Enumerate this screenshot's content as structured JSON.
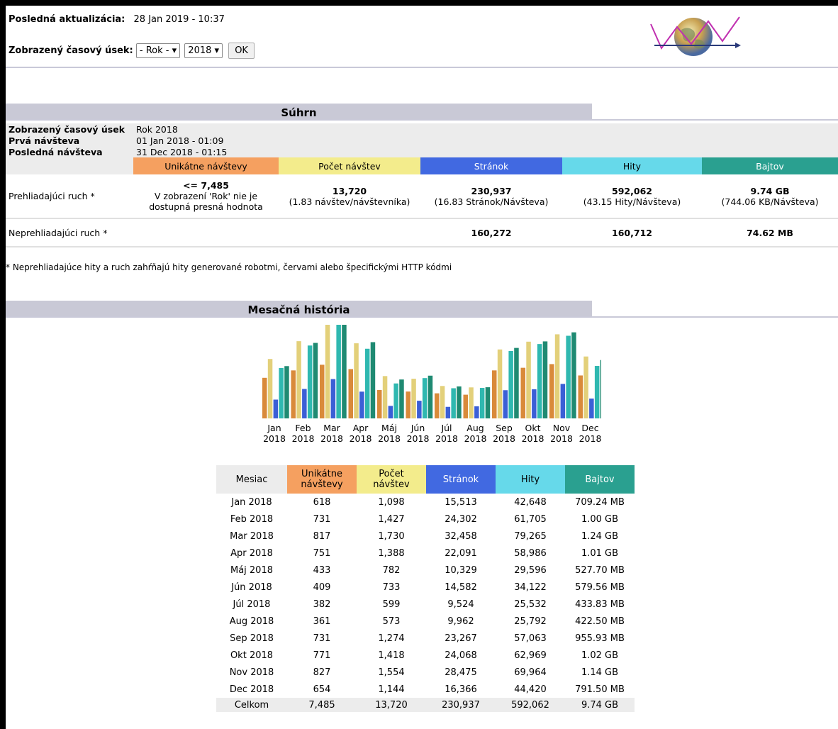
{
  "header": {
    "last_update_label": "Posledná aktualizácia:",
    "last_update_value": "28 Jan 2019 - 10:37",
    "period_label": "Zobrazený časový úsek:",
    "period_select_value": "- Rok -",
    "year_select_value": "2018",
    "ok_label": "OK"
  },
  "summary": {
    "title": "Súhrn",
    "rows": [
      {
        "label": "Zobrazený časový úsek",
        "value": "Rok 2018"
      },
      {
        "label": "Prvá návšteva",
        "value": "01 Jan 2018 - 01:09"
      },
      {
        "label": "Posledná návšteva",
        "value": "31 Dec 2018 - 01:15"
      }
    ],
    "col_headers": [
      "Unikátne návštevy",
      "Počet návštev",
      "Stránok",
      "Hity",
      "Bajtov"
    ],
    "viewed": {
      "label": "Prehliadajúci ruch *",
      "uniq_value": "<= 7,485",
      "uniq_note_1": "V zobrazení 'Rok' nie je",
      "uniq_note_2": "dostupná presná hodnota",
      "visits_value": "13,720",
      "visits_note": "(1.83 návštev/návštevníka)",
      "pages_value": "230,937",
      "pages_note": "(16.83 Stránok/Návšteva)",
      "hits_value": "592,062",
      "hits_note": "(43.15 Hity/Návšteva)",
      "bytes_value": "9.74 GB",
      "bytes_note": "(744.06 KB/Návšteva)"
    },
    "nonviewed": {
      "label": "Neprehliadajúci ruch *",
      "pages_value": "160,272",
      "hits_value": "160,712",
      "bytes_value": "74.62 MB"
    },
    "footnote": "* Neprehliadajúce hity a ruch zahŕňajú hity generované robotmi, červami alebo špecifickými HTTP kódmi"
  },
  "monthly": {
    "title": "Mesačná história",
    "headers": [
      "Mesiac",
      "Unikátne návštevy",
      "Počet návštev",
      "Stránok",
      "Hity",
      "Bajtov"
    ],
    "rows": [
      [
        "Jan 2018",
        "618",
        "1,098",
        "15,513",
        "42,648",
        "709.24 MB"
      ],
      [
        "Feb 2018",
        "731",
        "1,427",
        "24,302",
        "61,705",
        "1.00 GB"
      ],
      [
        "Mar 2018",
        "817",
        "1,730",
        "32,458",
        "79,265",
        "1.24 GB"
      ],
      [
        "Apr 2018",
        "751",
        "1,388",
        "22,091",
        "58,986",
        "1.01 GB"
      ],
      [
        "Máj 2018",
        "433",
        "782",
        "10,329",
        "29,596",
        "527.70 MB"
      ],
      [
        "Jún 2018",
        "409",
        "733",
        "14,582",
        "34,122",
        "579.56 MB"
      ],
      [
        "Júl 2018",
        "382",
        "599",
        "9,524",
        "25,532",
        "433.83 MB"
      ],
      [
        "Aug 2018",
        "361",
        "573",
        "9,962",
        "25,792",
        "422.50 MB"
      ],
      [
        "Sep 2018",
        "731",
        "1,274",
        "23,267",
        "57,063",
        "955.93 MB"
      ],
      [
        "Okt 2018",
        "771",
        "1,418",
        "24,068",
        "62,969",
        "1.02 GB"
      ],
      [
        "Nov 2018",
        "827",
        "1,554",
        "28,475",
        "69,964",
        "1.14 GB"
      ],
      [
        "Dec 2018",
        "654",
        "1,144",
        "16,366",
        "44,420",
        "791.50 MB"
      ]
    ],
    "total": [
      "Celkom",
      "7,485",
      "13,720",
      "230,937",
      "592,062",
      "9.74 GB"
    ]
  },
  "chart_data": {
    "type": "bar",
    "categories": [
      "Jan 2018",
      "Feb 2018",
      "Mar 2018",
      "Apr 2018",
      "Máj 2018",
      "Jún 2018",
      "Júl 2018",
      "Aug 2018",
      "Sep 2018",
      "Okt 2018",
      "Nov 2018",
      "Dec 2018"
    ],
    "month_labels": [
      "Jan",
      "Feb",
      "Mar",
      "Apr",
      "Máj",
      "Jún",
      "Júl",
      "Aug",
      "Sep",
      "Okt",
      "Nov",
      "Dec"
    ],
    "year_label": "2018",
    "series": [
      {
        "name": "Unikátne návštevy",
        "values": [
          618,
          731,
          817,
          751,
          433,
          409,
          382,
          361,
          731,
          771,
          827,
          654
        ],
        "color": "#d98a3a"
      },
      {
        "name": "Počet návštev",
        "values": [
          1098,
          1427,
          1730,
          1388,
          782,
          733,
          599,
          573,
          1274,
          1418,
          1554,
          1144
        ],
        "color": "#e3d07a"
      },
      {
        "name": "Stránok",
        "values": [
          15513,
          24302,
          32458,
          22091,
          10329,
          14582,
          9524,
          9962,
          23267,
          24068,
          28475,
          16366
        ],
        "color": "#3b5fd6"
      },
      {
        "name": "Hity",
        "values": [
          42648,
          61705,
          79265,
          58986,
          29596,
          34122,
          25532,
          25792,
          57063,
          62969,
          69964,
          44420
        ],
        "color": "#2fb8b0"
      },
      {
        "name": "Bajtov",
        "values": [
          709.24,
          1024,
          1269.76,
          1034.24,
          527.7,
          579.56,
          433.83,
          422.5,
          955.93,
          1044.48,
          1167.36,
          791.5
        ],
        "color": "#1f8a72"
      }
    ]
  }
}
